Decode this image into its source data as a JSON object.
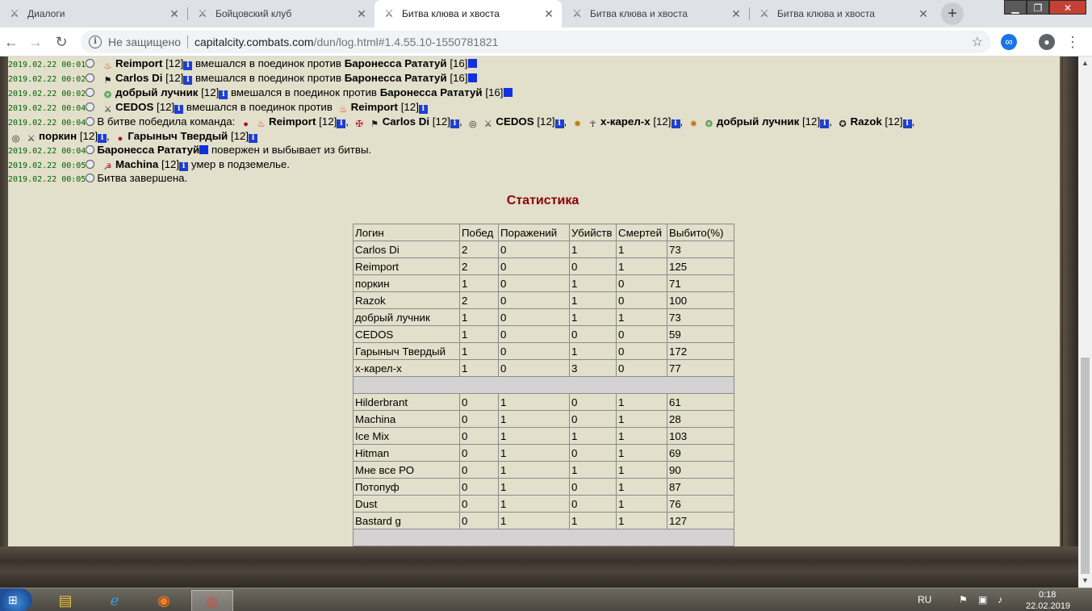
{
  "tabs": [
    {
      "title": "Диалоги",
      "icon": "dialogs-icon"
    },
    {
      "title": "Бойцовский клуб",
      "icon": "crossed-swords-icon"
    },
    {
      "title": "Битва клюва и хвоста",
      "icon": "crossed-swords-icon"
    },
    {
      "title": "Битва клюва и хвоста",
      "icon": "crossed-swords-icon"
    },
    {
      "title": "Битва клюва и хвоста",
      "icon": "crossed-swords-icon"
    }
  ],
  "address": {
    "security": "Не защищено",
    "host": "capitalcity.combats.com",
    "path": "/dun/log.html#1.4.55.10-1550781821"
  },
  "log": {
    "lines": [
      {
        "ts": "2019.02.22 00:01",
        "a": "Reimport",
        "a_lvl": "[12]",
        "text": "вмешался в поединок против",
        "b": "Баронесса Рататуй",
        "b_lvl": "[16]"
      },
      {
        "ts": "2019.02.22 00:02",
        "a": "Carlos Di",
        "a_lvl": "[12]",
        "text": "вмешался в поединок против",
        "b": "Баронесса Рататуй",
        "b_lvl": "[16]"
      },
      {
        "ts": "2019.02.22 00:02",
        "a": "добрый лучник",
        "a_lvl": "[12]",
        "text": "вмешался в поединок против",
        "b": "Баронесса Рататуй",
        "b_lvl": "[16]"
      },
      {
        "ts": "2019.02.22 00:04",
        "a": "CEDOS",
        "a_lvl": "[12]",
        "text": "вмешался в поединок против",
        "b": "Reimport",
        "b_lvl": "[12]"
      }
    ],
    "victory": {
      "ts": "2019.02.22 00:04",
      "text": "В битве победила команда:",
      "members": [
        {
          "name": "Reimport",
          "lvl": "[12]"
        },
        {
          "name": "Carlos Di",
          "lvl": "[12]"
        },
        {
          "name": "CEDOS",
          "lvl": "[12]"
        },
        {
          "name": "x-карел-x",
          "lvl": "[12]"
        },
        {
          "name": "добрый лучник",
          "lvl": "[12]"
        },
        {
          "name": "Razok",
          "lvl": "[12]"
        },
        {
          "name": "поркин",
          "lvl": "[12]"
        },
        {
          "name": "Гарыныч Твердый",
          "lvl": "[12]"
        }
      ]
    },
    "defeated": {
      "ts": "2019.02.22 00:04",
      "name": "Баронесса Рататуй",
      "text": "повержен и выбывает из битвы."
    },
    "died": {
      "ts": "2019.02.22 00:05",
      "name": "Machina",
      "lvl": "[12]",
      "text": "умер в подземелье."
    },
    "end": {
      "ts": "2019.02.22 00:05",
      "text": "Битва завершена."
    }
  },
  "stats": {
    "title": "Статистика",
    "headers": [
      "Логин",
      "Побед",
      "Поражений",
      "Убийств",
      "Смертей",
      "Выбито(%)"
    ],
    "winners": [
      [
        "Carlos Di",
        "2",
        "0",
        "1",
        "1",
        "73"
      ],
      [
        "Reimport",
        "2",
        "0",
        "0",
        "1",
        "125"
      ],
      [
        "поркин",
        "1",
        "0",
        "1",
        "0",
        "71"
      ],
      [
        "Razok",
        "2",
        "0",
        "1",
        "0",
        "100"
      ],
      [
        "добрый лучник",
        "1",
        "0",
        "1",
        "1",
        "73"
      ],
      [
        "CEDOS",
        "1",
        "0",
        "0",
        "0",
        "59"
      ],
      [
        "Гарыныч Твердый",
        "1",
        "0",
        "1",
        "0",
        "172"
      ],
      [
        "x-карел-x",
        "1",
        "0",
        "3",
        "0",
        "77"
      ]
    ],
    "losers": [
      [
        "Hilderbrant",
        "0",
        "1",
        "0",
        "1",
        "61"
      ],
      [
        "Machina",
        "0",
        "1",
        "0",
        "1",
        "28"
      ],
      [
        "Ice Mix",
        "0",
        "1",
        "1",
        "1",
        "103"
      ],
      [
        "Hitman",
        "0",
        "1",
        "0",
        "1",
        "69"
      ],
      [
        "Мне все РО",
        "0",
        "1",
        "1",
        "1",
        "90"
      ],
      [
        "Потопуф",
        "0",
        "1",
        "0",
        "1",
        "87"
      ],
      [
        "Dust",
        "0",
        "1",
        "0",
        "1",
        "76"
      ],
      [
        "Bastard g",
        "0",
        "1",
        "1",
        "1",
        "127"
      ]
    ]
  },
  "taskbar": {
    "lang": "RU",
    "time": "0:18",
    "date": "22.02.2019"
  },
  "colors": {
    "parchment": "#e2dfcb",
    "title_red": "#8b0000",
    "timestamp_green": "#006400",
    "info_blue": "#1f3fcf"
  }
}
